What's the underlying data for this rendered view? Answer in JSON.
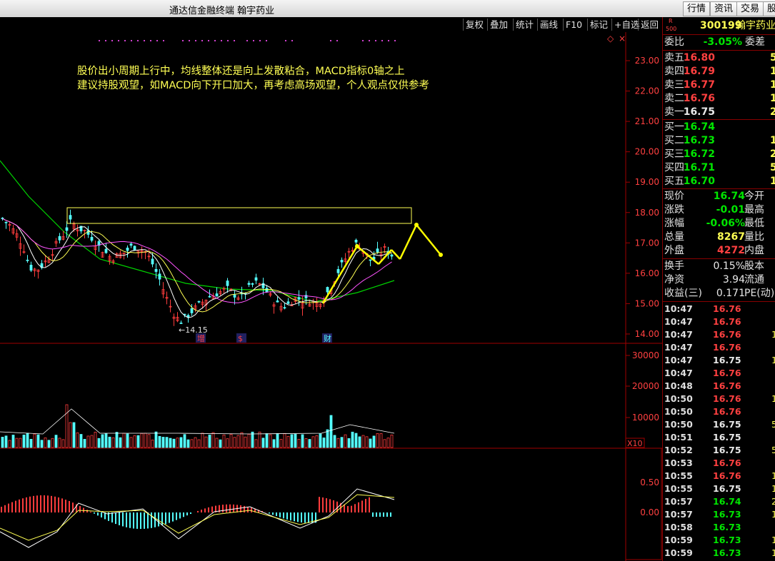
{
  "window": {
    "title": "通达信金融终端  翰宇药业"
  },
  "top_buttons": [
    "行情",
    "资讯",
    "交易",
    "股"
  ],
  "toolbar": [
    "复权",
    "叠加",
    "统计",
    "画线",
    "F10",
    "标记",
    "+自选",
    "返回"
  ],
  "annotation": {
    "line1": "股价出小周期上行中，均线整体还是向上发散粘合，MACD指标0轴之上",
    "line2": "建议持股观望，如MACD向下开口加大，再考虑高场观望，个人观点仅供参考"
  },
  "chart": {
    "price_ticks": [
      "23.00",
      "22.00",
      "21.00",
      "20.00",
      "19.00",
      "18.00",
      "17.00",
      "16.00",
      "15.00",
      "14.00"
    ],
    "low_label": "←14.15",
    "markers": [
      "增",
      "$",
      "财"
    ],
    "volume_ticks": [
      "30000",
      "20000",
      "10000"
    ],
    "volume_unit": "X10",
    "macd_ticks": [
      "0.50",
      "0.00"
    ],
    "colors": {
      "up": "#ff3c3c",
      "down": "#54ffff",
      "ma5": "#ffffff",
      "ma10": "#ffff54",
      "ma20": "#ff54ff",
      "ma60": "#00d200",
      "arrow": "#ffff00"
    }
  },
  "quote": {
    "badge_top": "R",
    "badge_bottom": "500",
    "code": "300199",
    "name": "翰宇药业",
    "weibi_label": "委比",
    "weibi_value": "-3.05%",
    "weicha_label": "委差",
    "asks": [
      {
        "label": "卖五",
        "price": "16.80",
        "vol": "5"
      },
      {
        "label": "卖四",
        "price": "16.79",
        "vol": "1"
      },
      {
        "label": "卖三",
        "price": "16.77",
        "vol": "1"
      },
      {
        "label": "卖二",
        "price": "16.76",
        "vol": "1"
      },
      {
        "label": "卖一",
        "price": "16.75",
        "vol": "2"
      }
    ],
    "bids": [
      {
        "label": "买一",
        "price": "16.74",
        "vol": ""
      },
      {
        "label": "买二",
        "price": "16.73",
        "vol": "1"
      },
      {
        "label": "买三",
        "price": "16.72",
        "vol": "2"
      },
      {
        "label": "买四",
        "price": "16.71",
        "vol": "5"
      },
      {
        "label": "买五",
        "price": "16.70",
        "vol": "1"
      }
    ],
    "stats": [
      {
        "label": "现价",
        "value": "16.74",
        "right": "今开"
      },
      {
        "label": "涨跌",
        "value": "-0.01",
        "right": "最高"
      },
      {
        "label": "涨幅",
        "value": "-0.06%",
        "right": "最低"
      },
      {
        "label": "总量",
        "value": "8267",
        "right": "量比"
      },
      {
        "label": "外盘",
        "value": "4272",
        "right": "内盘"
      }
    ],
    "stats2": [
      {
        "label": "换手",
        "value": "0.15%",
        "right": "股本"
      },
      {
        "label": "净资",
        "value": "3.94",
        "right": "流通"
      },
      {
        "label": "收益(三)",
        "value": "0.171",
        "right": "PE(动)"
      }
    ],
    "ticks": [
      {
        "time": "10:47",
        "price": "16.76",
        "vol": ""
      },
      {
        "time": "10:47",
        "price": "16.76",
        "vol": ""
      },
      {
        "time": "10:47",
        "price": "16.76",
        "vol": "1"
      },
      {
        "time": "10:47",
        "price": "16.76",
        "vol": ""
      },
      {
        "time": "10:47",
        "price": "16.75",
        "vol": "1"
      },
      {
        "time": "10:47",
        "price": "16.76",
        "vol": ""
      },
      {
        "time": "10:48",
        "price": "16.76",
        "vol": ""
      },
      {
        "time": "10:50",
        "price": "16.76",
        "vol": "1"
      },
      {
        "time": "10:50",
        "price": "16.76",
        "vol": ""
      },
      {
        "time": "10:50",
        "price": "16.75",
        "vol": "5"
      },
      {
        "time": "10:51",
        "price": "16.75",
        "vol": ""
      },
      {
        "time": "10:52",
        "price": "16.75",
        "vol": "5"
      },
      {
        "time": "10:53",
        "price": "16.76",
        "vol": ""
      },
      {
        "time": "10:55",
        "price": "16.76",
        "vol": "1"
      },
      {
        "time": "10:55",
        "price": "16.75",
        "vol": "1"
      },
      {
        "time": "10:57",
        "price": "16.74",
        "vol": "2"
      },
      {
        "time": "10:57",
        "price": "16.73",
        "vol": "1"
      },
      {
        "time": "10:58",
        "price": "16.73",
        "vol": ""
      },
      {
        "time": "10:59",
        "price": "16.73",
        "vol": "1"
      },
      {
        "time": "10:59",
        "price": "16.73",
        "vol": "1"
      }
    ]
  }
}
